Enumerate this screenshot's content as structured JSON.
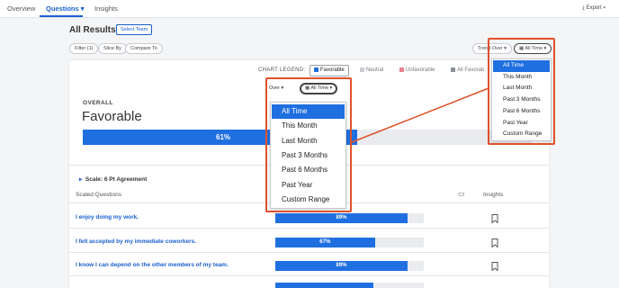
{
  "nav": {
    "tabs": [
      {
        "label": "Overview"
      },
      {
        "label": "Questions"
      },
      {
        "label": "Insights"
      }
    ],
    "export_label": "Export"
  },
  "header": {
    "title": "All Results",
    "select_team": "Select Team"
  },
  "filters": {
    "filter": "Filter (1)",
    "slice_by": "Slice By",
    "compare_to": "Compare To",
    "trend_over": "Trend Over",
    "all_time": "All Time"
  },
  "legend": {
    "title": "CHART LEGEND:",
    "items": [
      {
        "label": "Favorable",
        "color": "#1f6fe0"
      },
      {
        "label": "Neutral",
        "color": "#c9ccd1"
      },
      {
        "label": "Unfavorable",
        "color": "#e8818f"
      },
      {
        "label": "All Favorab",
        "color": "#8a8f96"
      }
    ]
  },
  "overall": {
    "label": "OVERALL",
    "value": "Favorable",
    "percent_label": "61%",
    "fraction": 0.61
  },
  "scale": {
    "label": "Scale: 6 Pt Agreement"
  },
  "columns": {
    "scaled_questions": "Scaled Questions",
    "insights": "Insights"
  },
  "questions": [
    {
      "label": "I enjoy doing my work.",
      "percent_label": "89%",
      "fraction": 0.89
    },
    {
      "label": "I felt accepted by my immediate coworkers.",
      "percent_label": "67%",
      "fraction": 0.67
    },
    {
      "label": "I know I can depend on the other members of my team.",
      "percent_label": "89%",
      "fraction": 0.89
    },
    {
      "label": "",
      "percent_label": "",
      "fraction": 0.66
    }
  ],
  "zoom_controls": {
    "over": "Over",
    "all_time": "All Time"
  },
  "time_menu": {
    "options": [
      "All Time",
      "This Month",
      "Last Month",
      "Past 3 Months",
      "Past 6 Months",
      "Past Year",
      "Custom Range"
    ],
    "selected": "All Time"
  },
  "colors": {
    "accent": "#1f6fe0",
    "callout": "#e0512a"
  }
}
